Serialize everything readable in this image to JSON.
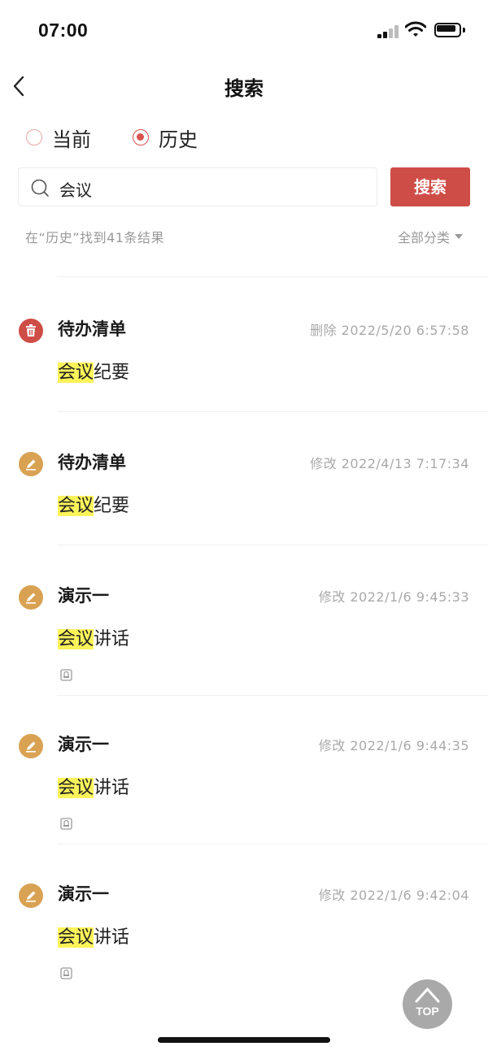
{
  "status_bar": {
    "time": "07:00"
  },
  "nav": {
    "title": "搜索"
  },
  "scope": {
    "options": [
      {
        "label": "当前",
        "checked": false
      },
      {
        "label": "历史",
        "checked": true
      }
    ]
  },
  "search": {
    "value": "会议",
    "button_label": "搜索"
  },
  "result_summary": "在“历史”找到41条结果",
  "category_filter": "全部分类",
  "items": [
    {
      "status": "deleted",
      "icon": "trash-icon",
      "title": "待办清单",
      "meta": "删除 2022/5/20 6:57:58",
      "snippet_highlight": "会议",
      "snippet_rest": "纪要",
      "has_attachment": false
    },
    {
      "status": "modified",
      "icon": "pencil-icon",
      "title": "待办清单",
      "meta": "修改 2022/4/13 7:17:34",
      "snippet_highlight": "会议",
      "snippet_rest": "纪要",
      "has_attachment": false
    },
    {
      "status": "modified",
      "icon": "pencil-icon",
      "title": "演示一",
      "meta": "修改 2022/1/6 9:45:33",
      "snippet_highlight": "会议",
      "snippet_rest": "讲话",
      "has_attachment": true
    },
    {
      "status": "modified",
      "icon": "pencil-icon",
      "title": "演示一",
      "meta": "修改 2022/1/6 9:44:35",
      "snippet_highlight": "会议",
      "snippet_rest": "讲话",
      "has_attachment": true
    },
    {
      "status": "modified",
      "icon": "pencil-icon",
      "title": "演示一",
      "meta": "修改 2022/1/6 9:42:04",
      "snippet_highlight": "会议",
      "snippet_rest": "讲话",
      "has_attachment": true
    }
  ],
  "back_to_top_label": "TOP",
  "colors": {
    "accent": "#cf4d47",
    "modified": "#d9a253",
    "highlight": "#fbf35a"
  }
}
